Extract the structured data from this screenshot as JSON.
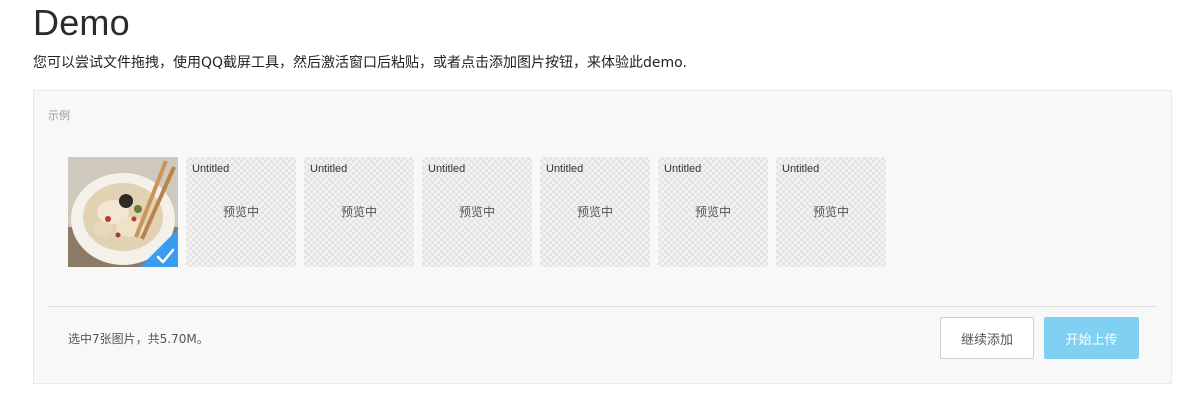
{
  "header": {
    "title": "Demo",
    "description": "您可以尝试文件拖拽，使用QQ截屏工具，然后激活窗口后粘贴，或者点击添加图片按钮，来体验此demo."
  },
  "panel": {
    "label": "示例"
  },
  "files": [
    {
      "type": "image",
      "selected": true,
      "icon": "checkmark-icon"
    },
    {
      "title": "Untitled",
      "status": "预览中"
    },
    {
      "title": "Untitled",
      "status": "预览中"
    },
    {
      "title": "Untitled",
      "status": "预览中"
    },
    {
      "title": "Untitled",
      "status": "预览中"
    },
    {
      "title": "Untitled",
      "status": "预览中"
    },
    {
      "title": "Untitled",
      "status": "预览中"
    }
  ],
  "footer": {
    "summary": "选中7张图片，共5.70M。",
    "add_label": "继续添加",
    "upload_label": "开始上传"
  },
  "colors": {
    "accent": "#7fd0f2",
    "check_badge": "#3a9bf0"
  }
}
